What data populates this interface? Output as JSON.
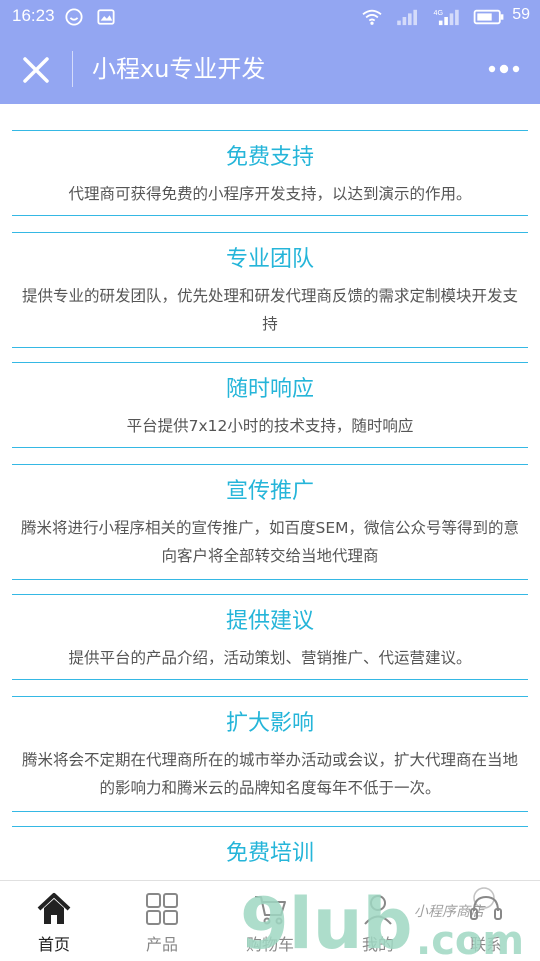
{
  "status": {
    "time": "16:23",
    "battery": "59"
  },
  "nav": {
    "title": "小程xu专业开发"
  },
  "cards": [
    {
      "title": "免费支持",
      "desc": "代理商可获得免费的小程序开发支持，以达到演示的作用。"
    },
    {
      "title": "专业团队",
      "desc": "提供专业的研发团队，优先处理和研发代理商反馈的需求定制模块开发支持"
    },
    {
      "title": "随时响应",
      "desc": "平台提供7x12小时的技术支持，随时响应"
    },
    {
      "title": "宣传推广",
      "desc": "腾米将进行小程序相关的宣传推广，如百度SEM，微信公众号等得到的意向客户将全部转交给当地代理商"
    },
    {
      "title": "提供建议",
      "desc": "提供平台的产品介绍，活动策划、营销推广、代运营建议。"
    },
    {
      "title": "扩大影响",
      "desc": "腾米将会不定期在代理商所在的城市举办活动或会议，扩大代理商在当地的影响力和腾米云的品牌知名度每年不低于一次。"
    },
    {
      "title": "免费培训",
      "desc": ""
    }
  ],
  "tabs": [
    {
      "label": "首页",
      "icon": "home-icon"
    },
    {
      "label": "产品",
      "icon": "grid-icon"
    },
    {
      "label": "购物车",
      "icon": "cart-icon"
    },
    {
      "label": "我的",
      "icon": "user-icon"
    },
    {
      "label": "联系",
      "icon": "contact-icon"
    }
  ],
  "watermark": {
    "brand_left": "9lub",
    "brand_right": ".com",
    "tagline": "小程序商店"
  },
  "colors": {
    "header": "#93a6f2",
    "accent": "#25b5d9",
    "divider": "#35b8e4",
    "watermark": "#9fd7c2"
  }
}
